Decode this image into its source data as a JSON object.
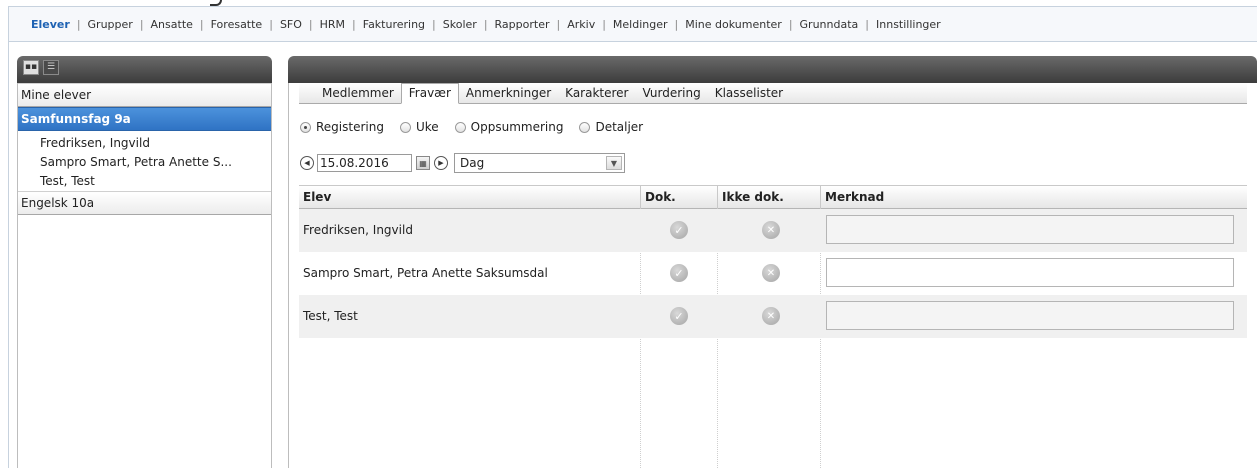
{
  "nav": {
    "items": [
      "Elever",
      "Grupper",
      "Ansatte",
      "Foresatte",
      "SFO",
      "HRM",
      "Fakturering",
      "Skoler",
      "Rapporter",
      "Arkiv",
      "Meldinger",
      "Mine dokumenter",
      "Grunndata",
      "Innstillinger"
    ],
    "active": "Elever"
  },
  "left": {
    "groups": {
      "mine": "Mine elever",
      "samfunnsfag": "Samfunnsfag 9a",
      "engelsk": "Engelsk 10a"
    },
    "students": [
      "Fredriksen, Ingvild",
      "Sampro Smart, Petra Anette S...",
      "Test, Test"
    ]
  },
  "tabs": [
    "Medlemmer",
    "Fravær",
    "Anmerkninger",
    "Karakterer",
    "Vurdering",
    "Klasselister"
  ],
  "active_tab": "Fravær",
  "radios": [
    "Registering",
    "Uke",
    "Oppsummering",
    "Detaljer"
  ],
  "selected_radio": "Registering",
  "date": {
    "value": "15.08.2016",
    "period": "Dag"
  },
  "grid": {
    "columns": [
      "Elev",
      "Dok.",
      "Ikke dok.",
      "Merknad"
    ],
    "rows": [
      {
        "elev": "Fredriksen, Ingvild",
        "merknad_enabled": false
      },
      {
        "elev": "Sampro Smart, Petra Anette Saksumsdal",
        "merknad_enabled": true
      },
      {
        "elev": "Test, Test",
        "merknad_enabled": false
      }
    ]
  },
  "icons": {
    "prev": "chevron-left-icon",
    "next": "chevron-right-icon",
    "calendar": "calendar-icon",
    "dok": "check-circle-icon",
    "ikke": "x-circle-icon"
  },
  "colors": {
    "accent": "#1e62b3",
    "selected_group": "#3a80d0",
    "panel_header": "#4a4a4a"
  }
}
